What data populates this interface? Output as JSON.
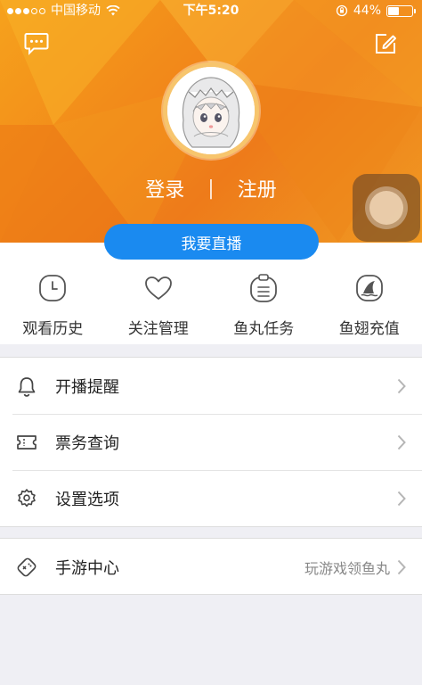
{
  "status_bar": {
    "carrier": "中国移动",
    "time": "下午5:20",
    "battery": "44%",
    "battery_level": 0.44
  },
  "header": {
    "login_label": "登录",
    "separator": "|",
    "register_label": "注册",
    "live_button_label": "我要直播",
    "colors": {
      "accent_orange": "#f28a1a",
      "live_blue": "#1a8af0"
    }
  },
  "quick_actions": [
    {
      "label": "观看历史",
      "icon": "clock-icon"
    },
    {
      "label": "关注管理",
      "icon": "heart-icon"
    },
    {
      "label": "鱼丸任务",
      "icon": "task-clipboard-icon"
    },
    {
      "label": "鱼翅充值",
      "icon": "shark-fin-icon"
    }
  ],
  "menu": [
    {
      "label": "开播提醒",
      "icon": "bell-icon"
    },
    {
      "label": "票务查询",
      "icon": "ticket-icon"
    },
    {
      "label": "设置选项",
      "icon": "gear-icon"
    }
  ],
  "game_center": {
    "label": "手游中心",
    "sub_label": "玩游戏领鱼丸",
    "icon": "gamepad-icon"
  }
}
